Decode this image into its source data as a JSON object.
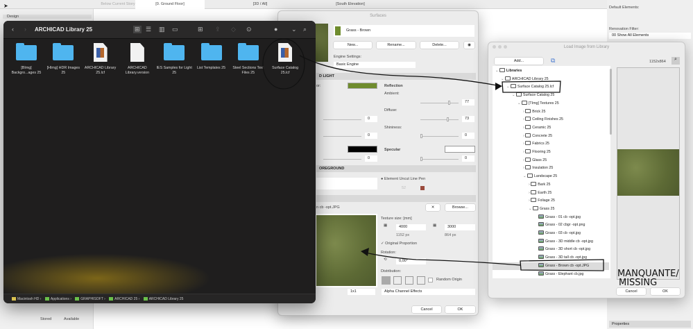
{
  "topbar": {
    "story_label": "Below Current Story",
    "tabs": [
      "[0. Ground Floor]",
      "[3D / All]",
      "[South Elevation]"
    ]
  },
  "toolbox": {
    "section": "Design",
    "table_headers": [
      "Stored",
      "Available"
    ]
  },
  "finder": {
    "title": "ARCHICAD Library 25",
    "items": [
      {
        "label": "[BImg] Backgro...ages 25",
        "type": "folder"
      },
      {
        "label": "[HImg] HDR Images 25",
        "type": "folder"
      },
      {
        "label": "ARCHICAD Library 25.lcf",
        "type": "lcf"
      },
      {
        "label": "ARCHICAD Library.version",
        "type": "doc"
      },
      {
        "label": "IES Samples for Light 25",
        "type": "folder"
      },
      {
        "label": "List Templates 25",
        "type": "folder"
      },
      {
        "label": "Steel Sections Text Files 25",
        "type": "folder"
      },
      {
        "label": "Surface Catalog 25.lcf",
        "type": "lcf"
      }
    ],
    "breadcrumb": [
      "Macintosh HD",
      "Applications",
      "GRAPHISOFT",
      "ARCHICAD 25",
      "ARCHICAD Library 25"
    ]
  },
  "surfaces": {
    "title": "Surfaces",
    "surface_name": "Grass - Brown",
    "new": "New...",
    "rename": "Rename...",
    "delete": "Delete...",
    "engine_label": "Engine Settings:",
    "engine_value": "Basic Engine",
    "light_section": "D LIGHT",
    "color_label": "or:",
    "reflection": "Reflection",
    "ambient": "Ambient:",
    "ambient_value": "77",
    "diffuse": "Diffuse:",
    "diffuse_value": "73",
    "shininess": "Shininess:",
    "shininess_value": "0",
    "specular": "Specular",
    "specular_value": "0",
    "left_values": [
      "0",
      "0",
      "0"
    ],
    "foreground_section": "OREGROUND",
    "uncut_pen": "Element Uncut Line Pen",
    "pen_number": "52",
    "texture_file": "n cb -opt.JPG",
    "browse": "Browse...",
    "texture_size": "Texture size: [mm]",
    "width": "4000",
    "height": "3000",
    "width_px": "1152 px",
    "height_px": "864 px",
    "original_proportion": "Original Proportion",
    "rotation": "Rotation:",
    "rotation_value": "0,00°",
    "distribution": "Distribution:",
    "random_origin": "Random Origin",
    "tiling": "1x1",
    "alpha": "Alpha Channel Effects",
    "cancel": "Cancel",
    "ok": "OK",
    "colors": {
      "surface": "#6f8c2e",
      "specular_swatch": "#000000"
    }
  },
  "load_image": {
    "title": "Load Image from Library",
    "add": "Add...",
    "dimensions": "1152x864",
    "cancel": "Cancel",
    "ok": "OK",
    "tree": [
      {
        "label": "Libraries",
        "level": 0,
        "exp": "v",
        "bold": true
      },
      {
        "label": "ARCHICAD Library 25",
        "level": 1,
        "exp": "v"
      },
      {
        "label": "Surface Catalog 25.lcf",
        "level": 2,
        "exp": "v"
      },
      {
        "label": "Surface Catalog 25",
        "level": 3,
        "exp": "v"
      },
      {
        "label": "[TImg] Textures 25",
        "level": 4,
        "exp": "v"
      },
      {
        "label": "Brick 25",
        "level": 5,
        "exp": ">"
      },
      {
        "label": "Ceiling Finishes 25",
        "level": 5,
        "exp": ">"
      },
      {
        "label": "Ceramic 25",
        "level": 5,
        "exp": ">"
      },
      {
        "label": "Concrete 25",
        "level": 5,
        "exp": ">"
      },
      {
        "label": "Fabrics 25",
        "level": 5,
        "exp": ">"
      },
      {
        "label": "Flooring 25",
        "level": 5,
        "exp": ">"
      },
      {
        "label": "Glass 25",
        "level": 5,
        "exp": ">"
      },
      {
        "label": "Insulation 25",
        "level": 5,
        "exp": ">"
      },
      {
        "label": "Landscape 25",
        "level": 5,
        "exp": "v"
      },
      {
        "label": "Bark 25",
        "level": 6,
        "exp": ">"
      },
      {
        "label": "Earth 25",
        "level": 6,
        "exp": ">"
      },
      {
        "label": "Foliage 25",
        "level": 6,
        "exp": ">"
      },
      {
        "label": "Grass 25",
        "level": 6,
        "exp": "v"
      },
      {
        "label": "Grass - 01 cb -opt.jpg",
        "level": 7,
        "img": true
      },
      {
        "label": "Grass - 02 cbgr -opt.png",
        "level": 7,
        "img": true
      },
      {
        "label": "Grass - 03 cb -opt.jpg",
        "level": 7,
        "img": true
      },
      {
        "label": "Grass - 3D middle cb -opt.jpg",
        "level": 7,
        "img": true
      },
      {
        "label": "Grass - 3D short cb -opt.jpg",
        "level": 7,
        "img": true
      },
      {
        "label": "Grass - 3D tall cb -opt.jpg",
        "level": 7,
        "img": true
      },
      {
        "label": "Grass - Brown cb -opt.JPG",
        "level": 7,
        "img": true,
        "selected": true
      },
      {
        "label": "Grass - Elephant cb.jpg",
        "level": 7,
        "img": true
      }
    ]
  },
  "right_panel": {
    "default_elements": "Default Elements:",
    "renovation_filter": "Renovation Filter:",
    "renovation_value": "00 Show All Elements",
    "properties": "Properties"
  },
  "annotation": {
    "line1": "MANQUANTE/",
    "line2": "MISSING"
  }
}
